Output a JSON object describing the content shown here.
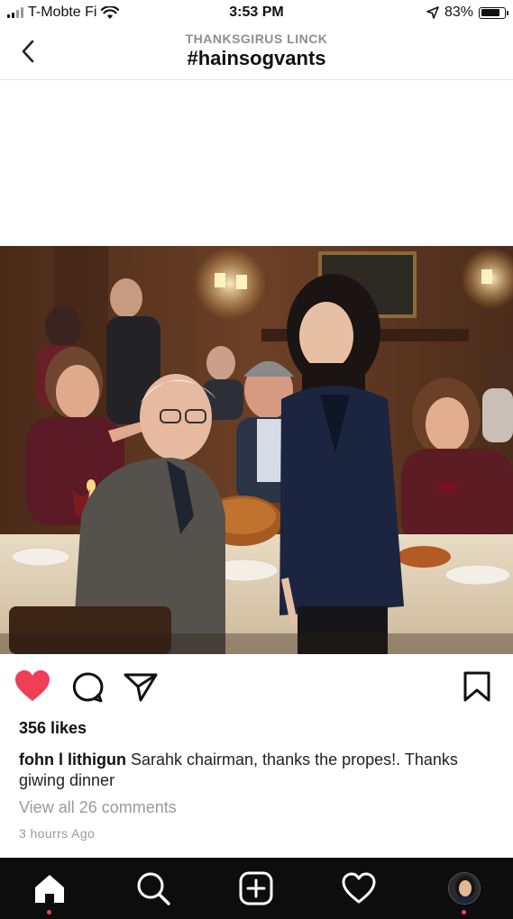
{
  "status_bar": {
    "carrier": "T-Mobte Fi",
    "time": "3:53 PM",
    "battery": "83%",
    "battery_level": 0.83
  },
  "header": {
    "subtitle": "THANKSGIRUS LINCK",
    "title": "#hainsogvants",
    "back_icon": "chevron-left-icon"
  },
  "post": {
    "image_alt": "Thanksgiving dinner scene",
    "liked": true,
    "like_color": "#ef3e55",
    "likes": "356 likes",
    "username": "fohn l lithigun",
    "caption": "Sarahk chairman, thanks the propes!. Thanks giwing dinner",
    "comments_link": "View all 26 comments",
    "timestamp": "3 hourrs Ago"
  },
  "nav": {
    "items": [
      "home-icon",
      "search-icon",
      "add-post-icon",
      "heart-icon",
      "profile-avatar"
    ],
    "active": "home-icon",
    "badge_color": "#ff3b5c"
  }
}
